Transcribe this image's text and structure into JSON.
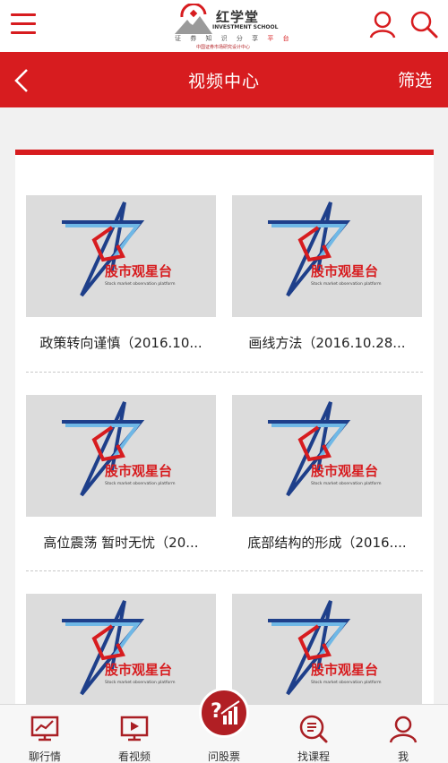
{
  "brand": {
    "name": "红学堂",
    "english": "INVESTMENT SCHOOL",
    "slogan_prefix": "证 券 知 识 分 享",
    "slogan_highlight": "平 台",
    "sub": "中国证券市场研究设计中心"
  },
  "header": {
    "title": "视频中心",
    "filter_label": "筛选"
  },
  "thumbnail": {
    "logo_text": "股市观星台",
    "logo_subtext": "Stock market observation platform"
  },
  "videos": [
    {
      "title": "政策转向谨慎（2016.10..."
    },
    {
      "title": "画线方法（2016.10.28..."
    },
    {
      "title": "高位震荡 暂时无忧（20..."
    },
    {
      "title": "底部结构的形成（2016...."
    },
    {
      "title": ""
    },
    {
      "title": ""
    }
  ],
  "bottom_nav": [
    {
      "label": "聊行情",
      "icon": "chart-monitor-icon"
    },
    {
      "label": "看视频",
      "icon": "video-play-icon"
    },
    {
      "label": "问股票",
      "icon": "question-chart-icon"
    },
    {
      "label": "找课程",
      "icon": "course-list-icon"
    },
    {
      "label": "我",
      "icon": "user-profile-icon"
    }
  ],
  "colors": {
    "brand_red": "#d71c1f",
    "thumb_bg": "#dcdcdc",
    "star_blue": "#1e3f8a",
    "star_light_blue": "#6fb8e6"
  }
}
